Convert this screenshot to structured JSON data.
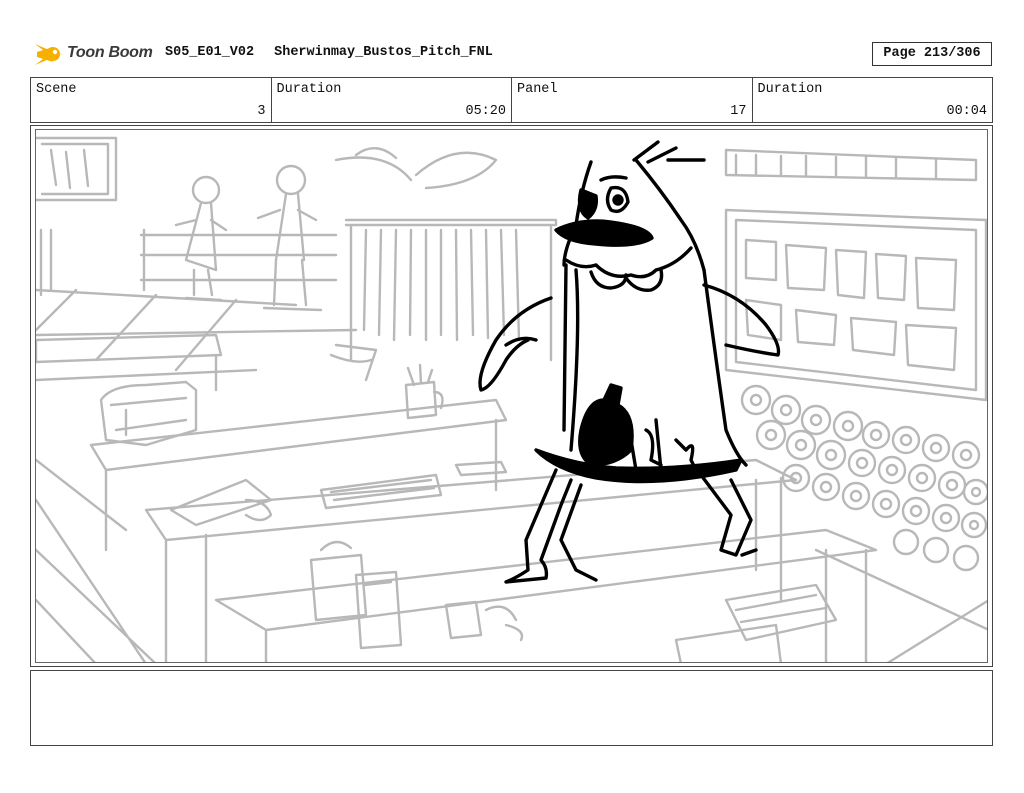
{
  "header": {
    "logo_text": "Toon Boom",
    "episode": "S05_E01_V02",
    "project_name": "Sherwinmay_Bustos_Pitch_FNL",
    "page": "Page 213/306"
  },
  "info": [
    {
      "label": "Scene",
      "value": "3"
    },
    {
      "label": "Duration",
      "value": "05:20"
    },
    {
      "label": "Panel",
      "value": "17"
    },
    {
      "label": "Duration",
      "value": "00:04"
    }
  ],
  "panel": {
    "description": ""
  },
  "notes": {
    "text": ""
  },
  "colors": {
    "logo_accent": "#f5b000",
    "sketch_background": "#b8b8b8",
    "sketch_character": "#000000"
  }
}
